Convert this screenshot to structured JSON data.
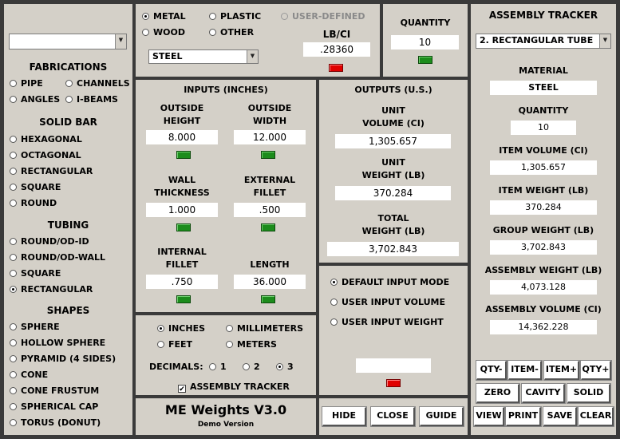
{
  "top_left_select": {
    "value": ""
  },
  "fabrications": {
    "title": "FABRICATIONS",
    "items": [
      "PIPE",
      "CHANNELS",
      "ANGLES",
      "I-BEAMS"
    ]
  },
  "solid_bar": {
    "title": "SOLID BAR",
    "items": [
      "HEXAGONAL",
      "OCTAGONAL",
      "RECTANGULAR",
      "SQUARE",
      "ROUND"
    ]
  },
  "tubing": {
    "title": "TUBING",
    "items": [
      "ROUND/OD-ID",
      "ROUND/OD-WALL",
      "SQUARE",
      "RECTANGULAR"
    ],
    "selected": "RECTANGULAR"
  },
  "shapes": {
    "title": "SHAPES",
    "items": [
      "SPHERE",
      "HOLLOW SPHERE",
      "PYRAMID (4 SIDES)",
      "CONE",
      "CONE FRUSTUM",
      "SPHERICAL CAP",
      "TORUS (DONUT)"
    ]
  },
  "material": {
    "options": [
      "METAL",
      "PLASTIC",
      "USER-DEFINED",
      "WOOD",
      "OTHER"
    ],
    "selected": "METAL",
    "select_value": "STEEL",
    "density_label": "LB/CI",
    "density_value": ".28360"
  },
  "quantity": {
    "label": "QUANTITY",
    "value": "10"
  },
  "inputs": {
    "title": "INPUTS  (INCHES)",
    "outside_height": {
      "label1": "OUTSIDE",
      "label2": "HEIGHT",
      "value": "8.000"
    },
    "outside_width": {
      "label1": "OUTSIDE",
      "label2": "WIDTH",
      "value": "12.000"
    },
    "wall_thickness": {
      "label1": "WALL",
      "label2": "THICKNESS",
      "value": "1.000"
    },
    "external_fillet": {
      "label1": "EXTERNAL",
      "label2": "FILLET",
      "value": ".500"
    },
    "internal_fillet": {
      "label1": "INTERNAL",
      "label2": "FILLET",
      "value": ".750"
    },
    "length": {
      "label": "LENGTH",
      "value": "36.000"
    }
  },
  "outputs": {
    "title": "OUTPUTS  (U.S.)",
    "unit_volume": {
      "label1": "UNIT",
      "label2": "VOLUME (CI)",
      "value": "1,305.657"
    },
    "unit_weight": {
      "label1": "UNIT",
      "label2": "WEIGHT (LB)",
      "value": "370.284"
    },
    "total_weight": {
      "label1": "TOTAL",
      "label2": "WEIGHT (LB)",
      "value": "3,702.843"
    }
  },
  "units": {
    "options": [
      "INCHES",
      "MILLIMETERS",
      "FEET",
      "METERS"
    ],
    "selected": "INCHES",
    "decimals_label": "DECIMALS:",
    "decimals": [
      "1",
      "2",
      "3"
    ],
    "decimals_selected": "3",
    "assembly_tracker_label": "ASSEMBLY TRACKER",
    "assembly_tracker_checked": true
  },
  "input_mode": {
    "options": [
      "DEFAULT INPUT MODE",
      "USER INPUT VOLUME",
      "USER INPUT WEIGHT"
    ],
    "selected": "DEFAULT INPUT MODE",
    "field_value": ""
  },
  "title_block": {
    "title": "ME Weights V3.0",
    "subtitle": "Demo Version"
  },
  "bottom_buttons": {
    "hide": "HIDE",
    "close": "CLOSE",
    "guide": "GUIDE"
  },
  "assembly_tracker": {
    "title": "ASSEMBLY TRACKER",
    "item_select": "2.  RECTANGULAR TUBE",
    "material": {
      "label": "MATERIAL",
      "value": "STEEL"
    },
    "quantity": {
      "label": "QUANTITY",
      "value": "10"
    },
    "item_volume": {
      "label": "ITEM VOLUME (CI)",
      "value": "1,305.657"
    },
    "item_weight": {
      "label": "ITEM WEIGHT (LB)",
      "value": "370.284"
    },
    "group_weight": {
      "label": "GROUP WEIGHT (LB)",
      "value": "3,702.843"
    },
    "assembly_weight": {
      "label": "ASSEMBLY WEIGHT (LB)",
      "value": "4,073.128"
    },
    "assembly_volume": {
      "label": "ASSEMBLY VOLUME (CI)",
      "value": "14,362.228"
    },
    "buttons": {
      "qty_minus": "QTY-",
      "item_minus": "ITEM-",
      "item_plus": "ITEM+",
      "qty_plus": "QTY+",
      "zero": "ZERO",
      "cavity": "CAVITY",
      "solid": "SOLID",
      "view": "VIEW",
      "print": "PRINT",
      "save": "SAVE",
      "clear": "CLEAR"
    }
  },
  "colors": {
    "panel": "#d4d0c8",
    "frame": "#3a3a3a",
    "indicator_green": "#1c8c1c",
    "indicator_red": "#e00000"
  }
}
